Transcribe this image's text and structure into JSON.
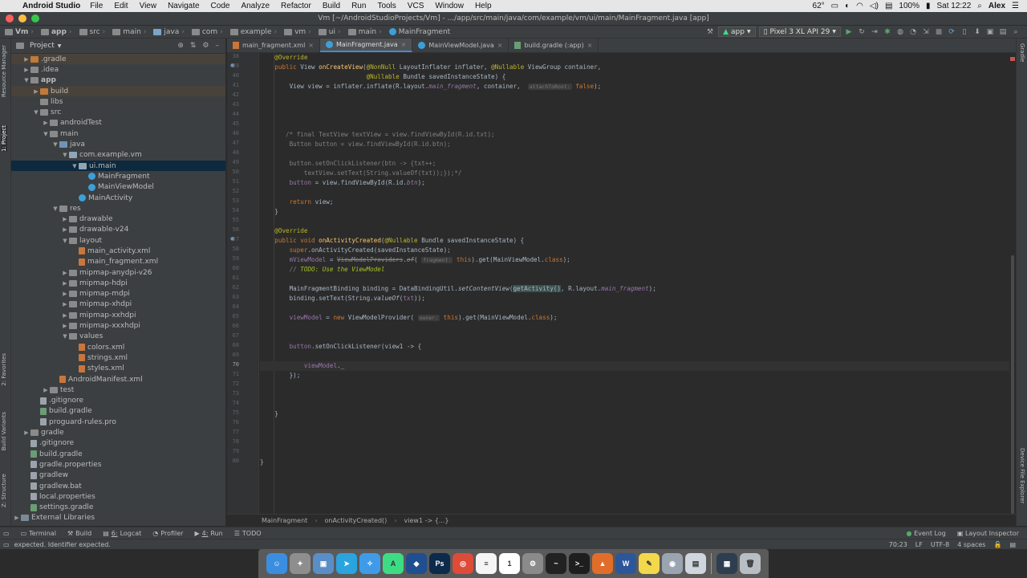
{
  "menubar": {
    "app": "Android Studio",
    "items": [
      "File",
      "Edit",
      "View",
      "Navigate",
      "Code",
      "Analyze",
      "Refactor",
      "Build",
      "Run",
      "Tools",
      "VCS",
      "Window",
      "Help"
    ],
    "temp": "62°",
    "battery": "100%",
    "time": "Sat 12:22",
    "user": "Alex"
  },
  "window": {
    "title": "Vm [~/AndroidStudioProjects/Vm] - .../app/src/main/java/com/example/vm/ui/main/MainFragment.java [app]"
  },
  "breadcrumbs": [
    "Vm",
    "app",
    "src",
    "main",
    "java",
    "com",
    "example",
    "vm",
    "ui",
    "main",
    "MainFragment"
  ],
  "run": {
    "config": "app",
    "device": "Pixel 3 XL API 29"
  },
  "side_tabs_left": [
    "Resource Manager",
    "1: Project",
    "2: Favorites",
    "Build Variants",
    "Z: Structure"
  ],
  "side_tabs_right": [
    "Gradle",
    "Device File Explorer"
  ],
  "project": {
    "header": "Project",
    "tree": [
      {
        "label": ".gradle",
        "depth": 1,
        "arrow": "▶",
        "icon": "foldorange",
        "state": "hl"
      },
      {
        "label": ".idea",
        "depth": 1,
        "arrow": "▶",
        "icon": "fold"
      },
      {
        "label": "app",
        "depth": 1,
        "arrow": "▼",
        "icon": "fold",
        "bold": true
      },
      {
        "label": "build",
        "depth": 2,
        "arrow": "▶",
        "icon": "foldorange",
        "state": "hl"
      },
      {
        "label": "libs",
        "depth": 2,
        "arrow": "",
        "icon": "fold"
      },
      {
        "label": "src",
        "depth": 2,
        "arrow": "▼",
        "icon": "fold"
      },
      {
        "label": "androidTest",
        "depth": 3,
        "arrow": "▶",
        "icon": "fold"
      },
      {
        "label": "main",
        "depth": 3,
        "arrow": "▼",
        "icon": "fold"
      },
      {
        "label": "java",
        "depth": 4,
        "arrow": "▼",
        "icon": "foldblue"
      },
      {
        "label": "com.example.vm",
        "depth": 5,
        "arrow": "▼",
        "icon": "pkg"
      },
      {
        "label": "ui.main",
        "depth": 6,
        "arrow": "▼",
        "icon": "pkg",
        "state": "sel"
      },
      {
        "label": "MainFragment",
        "depth": 7,
        "arrow": "",
        "icon": "java"
      },
      {
        "label": "MainViewModel",
        "depth": 7,
        "arrow": "",
        "icon": "java"
      },
      {
        "label": "MainActivity",
        "depth": 6,
        "arrow": "",
        "icon": "java"
      },
      {
        "label": "res",
        "depth": 4,
        "arrow": "▼",
        "icon": "fold"
      },
      {
        "label": "drawable",
        "depth": 5,
        "arrow": "▶",
        "icon": "fold"
      },
      {
        "label": "drawable-v24",
        "depth": 5,
        "arrow": "▶",
        "icon": "fold"
      },
      {
        "label": "layout",
        "depth": 5,
        "arrow": "▼",
        "icon": "fold"
      },
      {
        "label": "main_activity.xml",
        "depth": 6,
        "arrow": "",
        "icon": "xml"
      },
      {
        "label": "main_fragment.xml",
        "depth": 6,
        "arrow": "",
        "icon": "xml"
      },
      {
        "label": "mipmap-anydpi-v26",
        "depth": 5,
        "arrow": "▶",
        "icon": "fold"
      },
      {
        "label": "mipmap-hdpi",
        "depth": 5,
        "arrow": "▶",
        "icon": "fold"
      },
      {
        "label": "mipmap-mdpi",
        "depth": 5,
        "arrow": "▶",
        "icon": "fold"
      },
      {
        "label": "mipmap-xhdpi",
        "depth": 5,
        "arrow": "▶",
        "icon": "fold"
      },
      {
        "label": "mipmap-xxhdpi",
        "depth": 5,
        "arrow": "▶",
        "icon": "fold"
      },
      {
        "label": "mipmap-xxxhdpi",
        "depth": 5,
        "arrow": "▶",
        "icon": "fold"
      },
      {
        "label": "values",
        "depth": 5,
        "arrow": "▼",
        "icon": "fold"
      },
      {
        "label": "colors.xml",
        "depth": 6,
        "arrow": "",
        "icon": "xml"
      },
      {
        "label": "strings.xml",
        "depth": 6,
        "arrow": "",
        "icon": "xml"
      },
      {
        "label": "styles.xml",
        "depth": 6,
        "arrow": "",
        "icon": "xml"
      },
      {
        "label": "AndroidManifest.xml",
        "depth": 4,
        "arrow": "",
        "icon": "xml"
      },
      {
        "label": "test",
        "depth": 3,
        "arrow": "▶",
        "icon": "fold"
      },
      {
        "label": ".gitignore",
        "depth": 2,
        "arrow": "",
        "icon": "file"
      },
      {
        "label": "build.gradle",
        "depth": 2,
        "arrow": "",
        "icon": "gradle"
      },
      {
        "label": "proguard-rules.pro",
        "depth": 2,
        "arrow": "",
        "icon": "file"
      },
      {
        "label": "gradle",
        "depth": 1,
        "arrow": "▶",
        "icon": "fold"
      },
      {
        "label": ".gitignore",
        "depth": 1,
        "arrow": "",
        "icon": "file"
      },
      {
        "label": "build.gradle",
        "depth": 1,
        "arrow": "",
        "icon": "gradle"
      },
      {
        "label": "gradle.properties",
        "depth": 1,
        "arrow": "",
        "icon": "file"
      },
      {
        "label": "gradlew",
        "depth": 1,
        "arrow": "",
        "icon": "file"
      },
      {
        "label": "gradlew.bat",
        "depth": 1,
        "arrow": "",
        "icon": "file"
      },
      {
        "label": "local.properties",
        "depth": 1,
        "arrow": "",
        "icon": "file"
      },
      {
        "label": "settings.gradle",
        "depth": 1,
        "arrow": "",
        "icon": "gradle"
      },
      {
        "label": "External Libraries",
        "depth": 0,
        "arrow": "▶",
        "icon": "lib"
      }
    ]
  },
  "tabs": [
    {
      "label": "main_fragment.xml",
      "icon": "xml"
    },
    {
      "label": "MainFragment.java",
      "icon": "java",
      "active": true
    },
    {
      "label": "MainViewModel.java",
      "icon": "java"
    },
    {
      "label": "build.gradle (:app)",
      "icon": "gradle"
    }
  ],
  "editor": {
    "current_line": 70,
    "lines": [
      {
        "n": "38",
        "html": "    <span class='an'>@Override</span>"
      },
      {
        "n": "39",
        "html": "    <span class='kw'>public</span> View <span class='fn'>onCreateView</span>(<span class='an'>@NonNull</span> LayoutInflater inflater, <span class='an'>@Nullable</span> ViewGroup container,"
      },
      {
        "n": "40",
        "html": "                             <span class='an'>@Nullable</span> Bundle savedInstanceState) {"
      },
      {
        "n": "41",
        "html": "        View view = inflater.inflate(R.layout.<span class='fd it'>main_fragment</span>, container,  <span class='hint'>attachToRoot:</span> <span class='kw'>false</span>);"
      },
      {
        "n": "42",
        "html": ""
      },
      {
        "n": "43",
        "html": ""
      },
      {
        "n": "44",
        "html": ""
      },
      {
        "n": "45",
        "html": ""
      },
      {
        "n": "46",
        "html": "       <span class='cm'>/* final TextView textView = view.findViewById(R.id.txt);</span>"
      },
      {
        "n": "47",
        "html": "        <span class='cm'>Button button = view.findViewById(R.id.btn);</span>"
      },
      {
        "n": "48",
        "html": ""
      },
      {
        "n": "49",
        "html": "        <span class='cm'>button.setOnClickListener(btn -> {txt++;</span>"
      },
      {
        "n": "50",
        "html": "            <span class='cm'>textView.setText(String.valueOf(txt));});*/</span>"
      },
      {
        "n": "51",
        "html": "        <span class='fd'>button</span> = view.findViewById(R.id.<span class='fd it'>btn</span>);"
      },
      {
        "n": "52",
        "html": ""
      },
      {
        "n": "53",
        "html": "        <span class='kw'>return</span> view;"
      },
      {
        "n": "54",
        "html": "    }"
      },
      {
        "n": "55",
        "html": ""
      },
      {
        "n": "56",
        "html": "    <span class='an'>@Override</span>"
      },
      {
        "n": "57",
        "html": "    <span class='kw'>public void</span> <span class='fn'>onActivityCreated</span>(<span class='an'>@Nullable</span> Bundle savedInstanceState) {"
      },
      {
        "n": "58",
        "html": "        <span class='kw'>super</span>.onActivityCreated(savedInstanceState);"
      },
      {
        "n": "59",
        "html": "        <span class='fd'>mViewModel</span> = <span class='st'>ViewModelProviders</span>.<span class='st it'>of</span>( <span class='hint'>fragment:</span> <span class='kw'>this</span>).get(MainViewModel.<span class='kw'>class</span>);"
      },
      {
        "n": "60",
        "html": "        <span class='cm'>// </span><span class='td'>TODO: Use the ViewModel</span>"
      },
      {
        "n": "61",
        "html": ""
      },
      {
        "n": "62",
        "html": "        MainFragmentBinding binding = DataBindingUtil.<span class='it'>setContentView</span>(<span style='background:#3b514d'>getActivity()</span>, R.layout.<span class='fd it'>main_fragment</span>);"
      },
      {
        "n": "63",
        "html": "        binding.setText(String.<span class='it'>valueOf</span>(<span class='fd'>txt</span>));"
      },
      {
        "n": "64",
        "html": ""
      },
      {
        "n": "65",
        "html": "        <span class='fd'>viewModel</span> = <span class='kw'>new</span> ViewModelProvider( <span class='hint'>owner:</span> <span class='kw'>this</span>).get(MainViewModel.<span class='kw'>class</span>);"
      },
      {
        "n": "66",
        "html": ""
      },
      {
        "n": "67",
        "html": ""
      },
      {
        "n": "68",
        "html": "        <span class='fd'>button</span>.setOnClickListener(view1 -> {"
      },
      {
        "n": "69",
        "html": ""
      },
      {
        "n": "70",
        "html": "            <span class='fd'>viewModel</span>._"
      },
      {
        "n": "71",
        "html": "        });"
      },
      {
        "n": "72",
        "html": ""
      },
      {
        "n": "73",
        "html": ""
      },
      {
        "n": "74",
        "html": ""
      },
      {
        "n": "75",
        "html": "    }"
      },
      {
        "n": "76",
        "html": ""
      },
      {
        "n": "77",
        "html": ""
      },
      {
        "n": "78",
        "html": ""
      },
      {
        "n": "79",
        "html": ""
      },
      {
        "n": "80",
        "html": "}"
      }
    ]
  },
  "code_breadcrumb": [
    "MainFragment",
    "onActivityCreated()",
    "view1 -> {...}"
  ],
  "tool_windows": [
    {
      "key": "",
      "label": "Terminal"
    },
    {
      "key": "",
      "label": "Build"
    },
    {
      "key": "6",
      "label": "Logcat"
    },
    {
      "key": "",
      "label": "Profiler"
    },
    {
      "key": "4",
      "label": "Run"
    },
    {
      "key": "",
      "label": "TODO"
    }
  ],
  "tool_windows_right": [
    "Event Log",
    "Layout Inspector"
  ],
  "status": {
    "message": "expected. Identifier expected.",
    "position": "70:23",
    "line_sep": "LF",
    "encoding": "UTF-8",
    "indent": "4 spaces"
  },
  "dock": [
    {
      "name": "finder",
      "color": "#3b8de0",
      "glyph": "☺"
    },
    {
      "name": "launchpad",
      "color": "#8e8e8e",
      "glyph": "✦"
    },
    {
      "name": "preview",
      "color": "#5a8ec7",
      "glyph": "▣"
    },
    {
      "name": "telegram",
      "color": "#2aa3df",
      "glyph": "➤"
    },
    {
      "name": "safari",
      "color": "#3f9be8",
      "glyph": "✧"
    },
    {
      "name": "android-studio",
      "color": "#3ddc84",
      "glyph": "A"
    },
    {
      "name": "virtualbox",
      "color": "#1f4e91",
      "glyph": "◆"
    },
    {
      "name": "photoshop",
      "color": "#0c2a4a",
      "glyph": "Ps"
    },
    {
      "name": "chrome",
      "color": "#dd4b39",
      "glyph": "◎"
    },
    {
      "name": "reminders",
      "color": "#f5f5f5",
      "glyph": "≡"
    },
    {
      "name": "calendar",
      "color": "#ffffff",
      "glyph": "1"
    },
    {
      "name": "system-preferences",
      "color": "#8a8a8a",
      "glyph": "⚙"
    },
    {
      "name": "activity-monitor",
      "color": "#222222",
      "glyph": "~"
    },
    {
      "name": "terminal",
      "color": "#1e1e1e",
      "glyph": ">_"
    },
    {
      "name": "matlab",
      "color": "#e16d2a",
      "glyph": "▲"
    },
    {
      "name": "word",
      "color": "#2b579a",
      "glyph": "W"
    },
    {
      "name": "stickies",
      "color": "#f2d84b",
      "glyph": "✎"
    },
    {
      "name": "disk-utility",
      "color": "#9aa5b1",
      "glyph": "◉"
    },
    {
      "name": "documents",
      "color": "#cfd6dd",
      "glyph": "▤"
    },
    {
      "name": "screen-capture",
      "color": "#2c3e50",
      "glyph": "▦"
    },
    {
      "name": "trash",
      "color": "#b8bec4",
      "glyph": "🗑"
    }
  ]
}
